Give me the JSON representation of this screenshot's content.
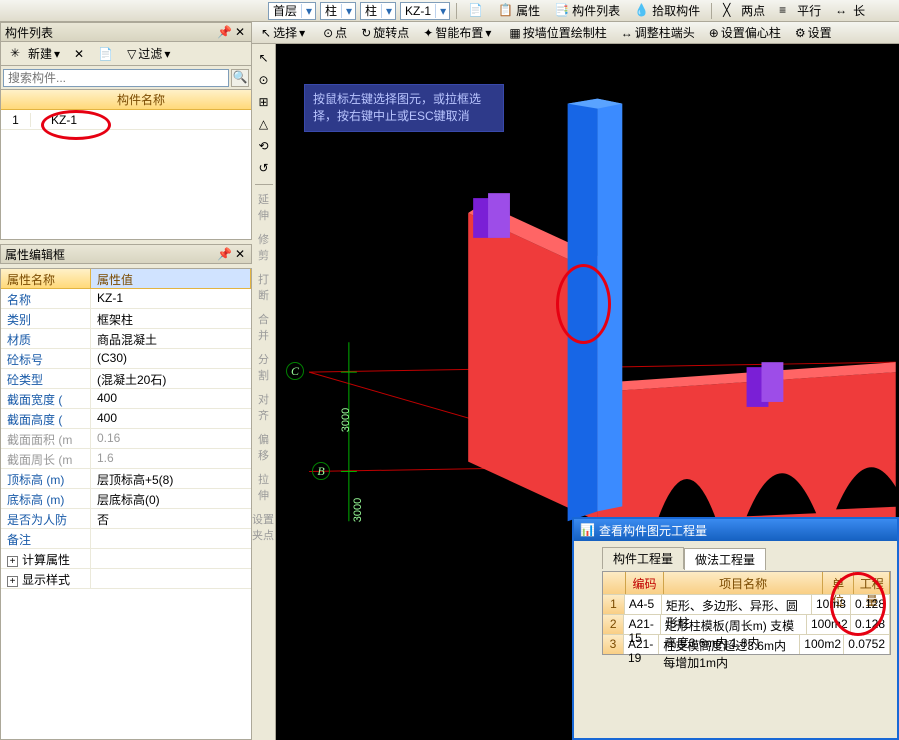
{
  "app": {
    "panel_list_title": "构件列表",
    "new_btn": "新建",
    "filter_btn": "过滤",
    "search_placeholder": "搜索构件...",
    "grid_header": "构件名称",
    "row1_idx": "1",
    "row1_name": "KZ-1"
  },
  "prop": {
    "title": "属性编辑框",
    "hdr_name": "属性名称",
    "hdr_val": "属性值",
    "rows": [
      {
        "n": "名称",
        "v": "KZ-1",
        "c": "blue"
      },
      {
        "n": "类别",
        "v": "框架柱",
        "c": "blue"
      },
      {
        "n": "材质",
        "v": "商品混凝土",
        "c": "blue"
      },
      {
        "n": "砼标号",
        "v": "(C30)",
        "c": "blue"
      },
      {
        "n": "砼类型",
        "v": "(混凝土20石)",
        "c": "blue"
      },
      {
        "n": "截面宽度 (",
        "v": "400",
        "c": "blue"
      },
      {
        "n": "截面高度 (",
        "v": "400",
        "c": "blue"
      },
      {
        "n": "截面面积 (m",
        "v": "0.16",
        "c": "gray"
      },
      {
        "n": "截面周长 (m",
        "v": "1.6",
        "c": "gray"
      },
      {
        "n": "顶标高 (m)",
        "v": "层顶标高+5(8)",
        "c": "blue"
      },
      {
        "n": "底标高 (m)",
        "v": "层底标高(0)",
        "c": "blue"
      },
      {
        "n": "是否为人防",
        "v": "否",
        "c": "blue"
      }
    ],
    "remark": "备注",
    "calc_attr": "计算属性",
    "disp_style": "显示样式"
  },
  "topbar": {
    "floor": "首层",
    "type1": "柱",
    "type2": "柱",
    "item": "KZ-1",
    "props": "属性",
    "list": "构件列表",
    "pick": "拾取构件",
    "two_pt": "两点",
    "parallel": "平行",
    "long": "长"
  },
  "toolbar2": {
    "select": "选择",
    "point": "点",
    "rotate": "旋转点",
    "smart": "智能布置",
    "by_wall": "按墙位置绘制柱",
    "adjust": "调整柱端头",
    "offset": "设置偏心柱",
    "set": "设置"
  },
  "hint": "按鼠标左键选择图元，或拉框选择，按右键中止或ESC键取消",
  "axis_c": "C",
  "axis_b": "B",
  "dim1": "3000",
  "dim2": "3000",
  "side_labels": [
    "延",
    "伸",
    "修",
    "剪",
    "打",
    "断",
    "合",
    "并",
    "分",
    "割",
    "对",
    "齐",
    "偏",
    "移",
    "拉",
    "伸",
    "设置夹点"
  ],
  "qty": {
    "title": "查看构件图元工程量",
    "tab1": "构件工程量",
    "tab2": "做法工程量",
    "h_code": "编码",
    "h_name": "项目名称",
    "h_unit": "单位",
    "h_amt": "工程量",
    "rows": [
      {
        "i": "1",
        "code": "A4-5",
        "name": "矩形、多边形、异形、圆形柱",
        "unit": "10m3",
        "amt": "0.128"
      },
      {
        "i": "2",
        "code": "A21-15",
        "name": "矩形柱模板(周长m) 支模高度3.6m内 1.8内",
        "unit": "100m2",
        "amt": "0.128"
      },
      {
        "i": "3",
        "code": "A21-19",
        "name": "柱支模高度超过3.6m内每增加1m内",
        "unit": "100m2",
        "amt": "0.0752"
      }
    ]
  }
}
